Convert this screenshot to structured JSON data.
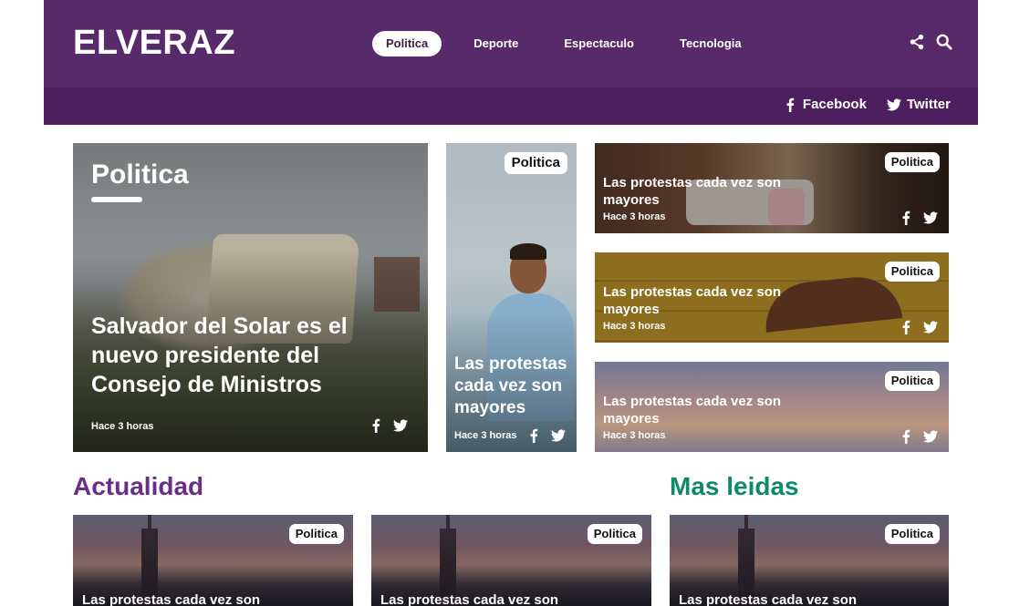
{
  "site": {
    "logo": "ELVERAZ",
    "nav": [
      "Politica",
      "Deporte",
      "Espectaculo",
      "Tecnologia"
    ],
    "active_nav": "Politica",
    "header_icons": [
      "share-icon",
      "search-icon"
    ],
    "social": {
      "facebook": "Facebook",
      "twitter": "Twitter"
    }
  },
  "featured": {
    "category": "Politica",
    "title": "Salvador del Solar es el nuevo presidente del Consejo de Ministros",
    "time": "Hace 3 horas"
  },
  "tall": {
    "tag": "Politica",
    "title": "Las protestas cada vez son mayores",
    "time": "Hace 3 horas"
  },
  "side": [
    {
      "tag": "Politica",
      "title": "Las protestas cada vez son mayores",
      "time": "Hace 3 horas"
    },
    {
      "tag": "Politica",
      "title": "Las protestas cada vez son mayores",
      "time": "Hace 3 horas"
    },
    {
      "tag": "Politica",
      "title": "Las protestas cada vez son mayores",
      "time": "Hace 3 horas"
    }
  ],
  "sections": {
    "actualidad": "Actualidad",
    "mas_leidas": "Mas leidas"
  },
  "bottom": [
    {
      "tag": "Politica",
      "title": "Las protestas cada vez son"
    },
    {
      "tag": "Politica",
      "title": "Las protestas cada vez son"
    },
    {
      "tag": "Politica",
      "title": "Las protestas cada vez son"
    }
  ],
  "colors": {
    "header": "#592a69",
    "social_bar": "#4d1f5e",
    "actualidad": "#6b2d8a",
    "mas_leidas": "#0d8a6a"
  }
}
